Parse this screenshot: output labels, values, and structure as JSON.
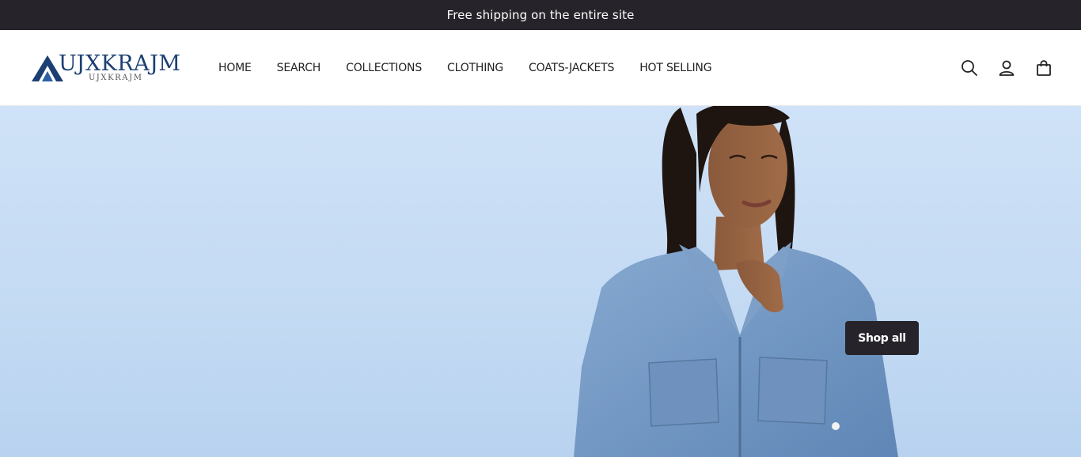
{
  "announcement": {
    "text": "Free shipping on the entire site"
  },
  "brand": {
    "name": "UJXKRAJM",
    "subtext": "UJXKRAJM"
  },
  "nav": {
    "items": [
      {
        "label": "HOME"
      },
      {
        "label": "SEARCH"
      },
      {
        "label": "COLLECTIONS"
      },
      {
        "label": "CLOTHING"
      },
      {
        "label": "COATS-JACKETS"
      },
      {
        "label": "HOT SELLING"
      }
    ]
  },
  "header_icons": [
    "search-icon",
    "account-icon",
    "cart-icon"
  ],
  "hero": {
    "cta_label": "Shop all",
    "image": "model-in-denim-jacket"
  },
  "colors": {
    "dark": "#26242a",
    "brand_blue": "#1c3f73",
    "hero_bg": "#c9def5",
    "denim": "#6f95c2"
  }
}
